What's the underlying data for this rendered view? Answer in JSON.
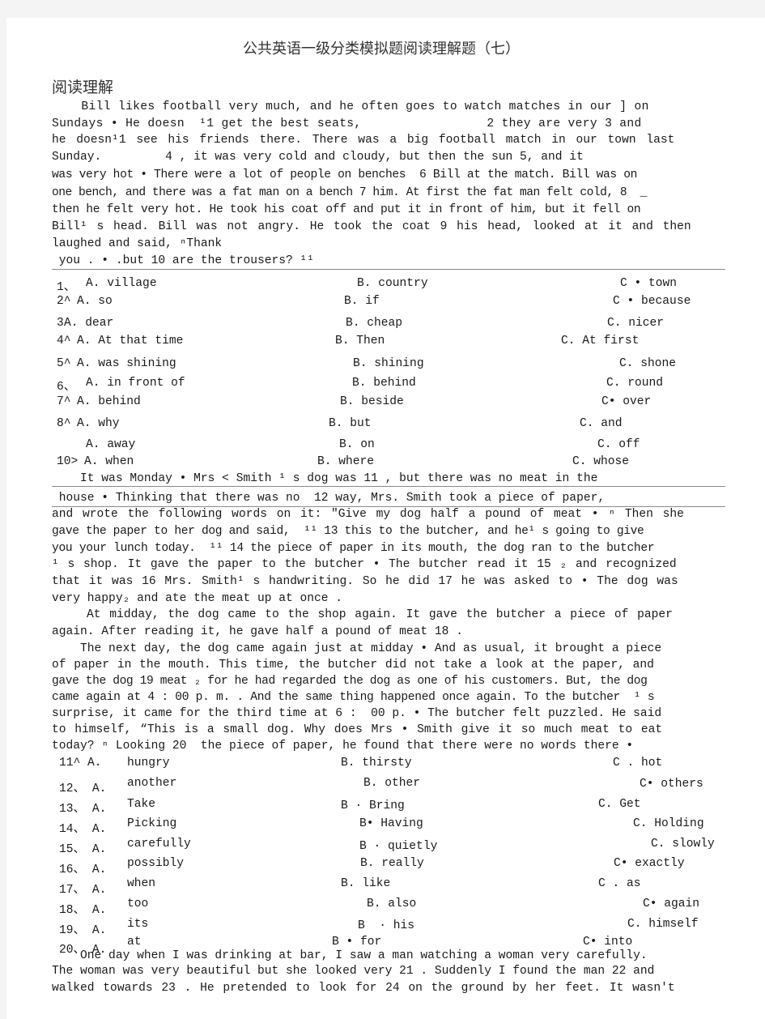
{
  "document": {
    "title": "公共英语一级分类模拟题阅读理解题（七）",
    "section": "阅读理解"
  },
  "passage1": {
    "lines": [
      "    Bill likes football very much, and he often goes to watch matches in our ] on",
      "Sundays • He doesn  ¹1 get the best seats,                 2 they are very 3 and",
      "he doesn¹1 see his friends there. There was a big football match in our town last",
      "Sunday.         4 , it was very cold and cloudy, but then the sun 5, and it",
      "was very hot • There were a lot of people on benches  6 Bill at the match. Bill was on",
      "one bench, and there was a fat man on a bench 7 him. At first the fat man felt cold, 8  _",
      "then he felt very hot. He took his coat off and put it in front of him, but it fell on",
      "Bill¹ s head. Bill was not angry. He took the coat 9 his head, looked at it and then",
      "laughed and said, ⁿThank",
      " you . • .but 10 are the trousers? ¹¹"
    ]
  },
  "questions1": [
    {
      "num": "1、",
      "a": "A. village",
      "b": "B. country",
      "c": "C • town"
    },
    {
      "num": "2^",
      "a": "A. so",
      "b": "B. if",
      "c": "C • because"
    },
    {
      "num": "3",
      "a": "A. dear",
      "b": "B. cheap",
      "c": "C. nicer"
    },
    {
      "num": "4^",
      "a": "A. At that time",
      "b": "B. Then",
      "c": "C. At first"
    },
    {
      "num": "5^",
      "a": "A. was shining",
      "b": "B. shining",
      "c": "C. shone"
    },
    {
      "num": "6、",
      "a": "A. in front of",
      "b": "B. behind",
      "c": "C. round"
    },
    {
      "num": "7^",
      "a": "A. behind",
      "b": "B. beside",
      "c": "C• over"
    },
    {
      "num": "8^",
      "a": "A. why",
      "b": "B. but",
      "c": "C. and"
    },
    {
      "num": "",
      "a": "A. away",
      "b": "B. on",
      "c": "C. off"
    },
    {
      "num": "10>",
      "a": "A. when",
      "b": "B. where",
      "c": "C. whose"
    }
  ],
  "passage2": {
    "lines": [
      "    It was Monday • Mrs < Smith ¹ s dog was 11 , but there was no meat in the",
      " house • Thinking that there was no  12 way, Mrs. Smith took a piece of paper,",
      "and wrote the following words on it: \"Give my dog half a pound of meat • ⁿ Then she",
      "gave the paper to her dog and said,  ¹¹ 13 this to the butcher, and he¹ s going to give",
      "you your lunch today.  ¹¹ 14 the piece of paper in its mouth, the dog ran to the butcher",
      "¹ s shop. It gave the paper to the butcher • The butcher read it 15 ₂ and recognized",
      "that it was 16 Mrs. Smith¹ s handwriting. So he did 17 he was asked to • The dog was",
      "very happy₂ and ate the meat up at once .",
      "    At midday, the dog came to the shop again. It gave the butcher a piece of paper",
      "again. After reading it, he gave half a pound of meat 18 .",
      "    The next day, the dog came again just at midday • And as usual, it brought a piece",
      "of paper in the mouth. This time, the butcher did not take a look at the paper, and",
      "gave the dog 19 meat ₂ for he had regarded the dog as one of his customers. But, the dog",
      "came again at 4 : 00 p. m. . And the same thing happened once again. To the butcher  ¹ s",
      "surprise, it came for the third time at 6 :  00 p. • The butcher felt puzzled. He said",
      "to himself, “This is a small dog. Why does Mrs • Smith give it so much meat to eat",
      "today? ⁿ Looking 20  the piece of paper, he found that there were no words there •"
    ]
  },
  "questions2": [
    {
      "num": "11^ A.",
      "a": "hungry",
      "b": "B. thirsty",
      "c": "C . hot"
    },
    {
      "num": "12、 A.",
      "a": "another",
      "b": "B. other",
      "c": "C• others"
    },
    {
      "num": "13、 A.",
      "a": "Take",
      "b": "B · Bring",
      "c": "C. Get"
    },
    {
      "num": "14、 A.",
      "a": "Picking",
      "b": "B• Having",
      "c": "C. Holding"
    },
    {
      "num": "15、 A.",
      "a": "carefully",
      "b": "B · quietly",
      "c": "C. slowly"
    },
    {
      "num": "16、 A.",
      "a": "possibly",
      "b": "B. really",
      "c": "C• exactly"
    },
    {
      "num": "17、 A.",
      "a": "when",
      "b": "B. like",
      "c": "C . as"
    },
    {
      "num": "18、 A.",
      "a": "too",
      "b": "B. also",
      "c": "C• again"
    },
    {
      "num": "19、 A.",
      "a": "its",
      "b": "B  · his",
      "c": "C. himself"
    },
    {
      "num": "20、 A.",
      "a": "at",
      "b": "B • for",
      "c": "C• into"
    }
  ],
  "passage3": {
    "lines": [
      "    One day when I was drinking at bar, I saw a man watching a woman very carefully.",
      "The woman was very beautiful but she looked very 21 . Suddenly I found the man 22 and",
      "walked towards 23 . He pretended to look for 24 on the ground by her feet. It wasn't"
    ]
  }
}
